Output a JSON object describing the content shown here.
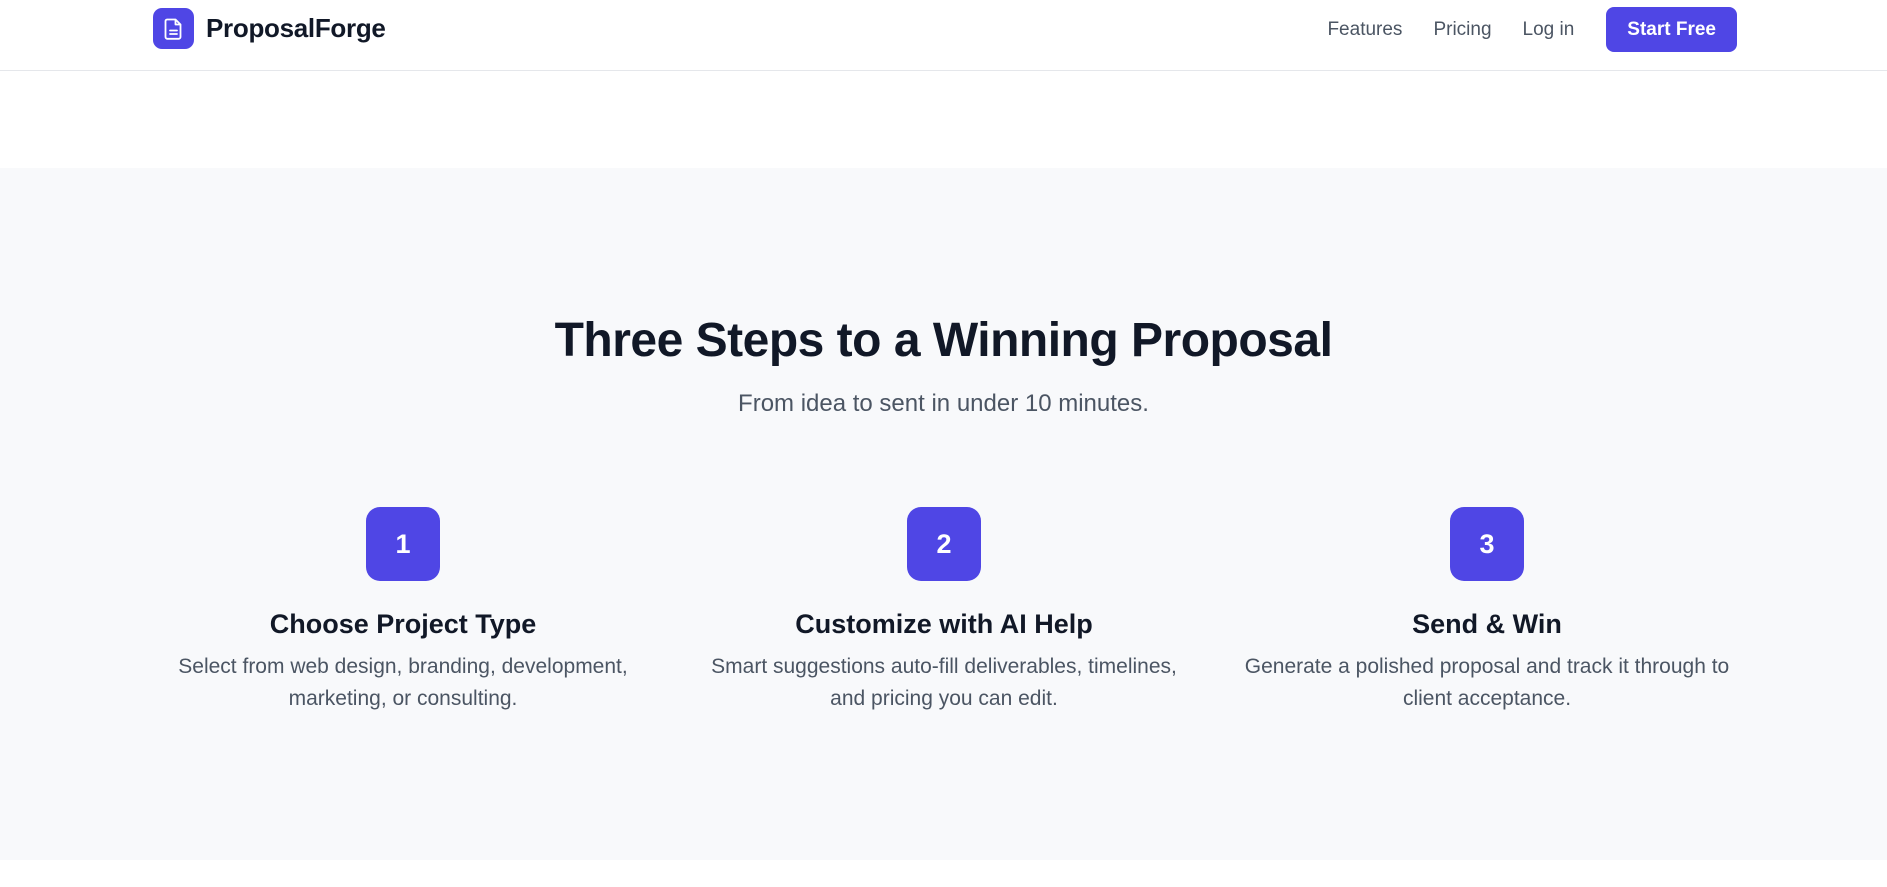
{
  "brand": {
    "name": "ProposalForge",
    "icon": "document-icon",
    "accent_color": "#4f46e5"
  },
  "nav": {
    "links": [
      "Features",
      "Pricing",
      "Log in"
    ],
    "cta_label": "Start Free"
  },
  "steps_section": {
    "title": "Three Steps to a Winning Proposal",
    "subtitle": "From idea to sent in under 10 minutes.",
    "steps": [
      {
        "number": "1",
        "title": "Choose Project Type",
        "description": "Select from web design, branding, development, marketing, or consulting."
      },
      {
        "number": "2",
        "title": "Customize with AI Help",
        "description": "Smart suggestions auto-fill deliverables, timelines, and pricing you can edit."
      },
      {
        "number": "3",
        "title": "Send & Win",
        "description": "Generate a polished proposal and track it through to client acceptance."
      }
    ]
  }
}
